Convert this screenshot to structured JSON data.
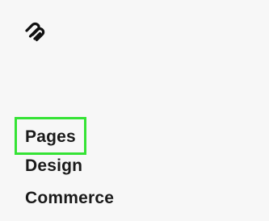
{
  "brand": {
    "logo_icon": "squarespace-logo-icon"
  },
  "nav": {
    "items": [
      {
        "label": "Pages",
        "active": true
      },
      {
        "label": "Design",
        "active": false
      },
      {
        "label": "Commerce",
        "active": false
      }
    ],
    "highlight_color": "#35e335"
  }
}
